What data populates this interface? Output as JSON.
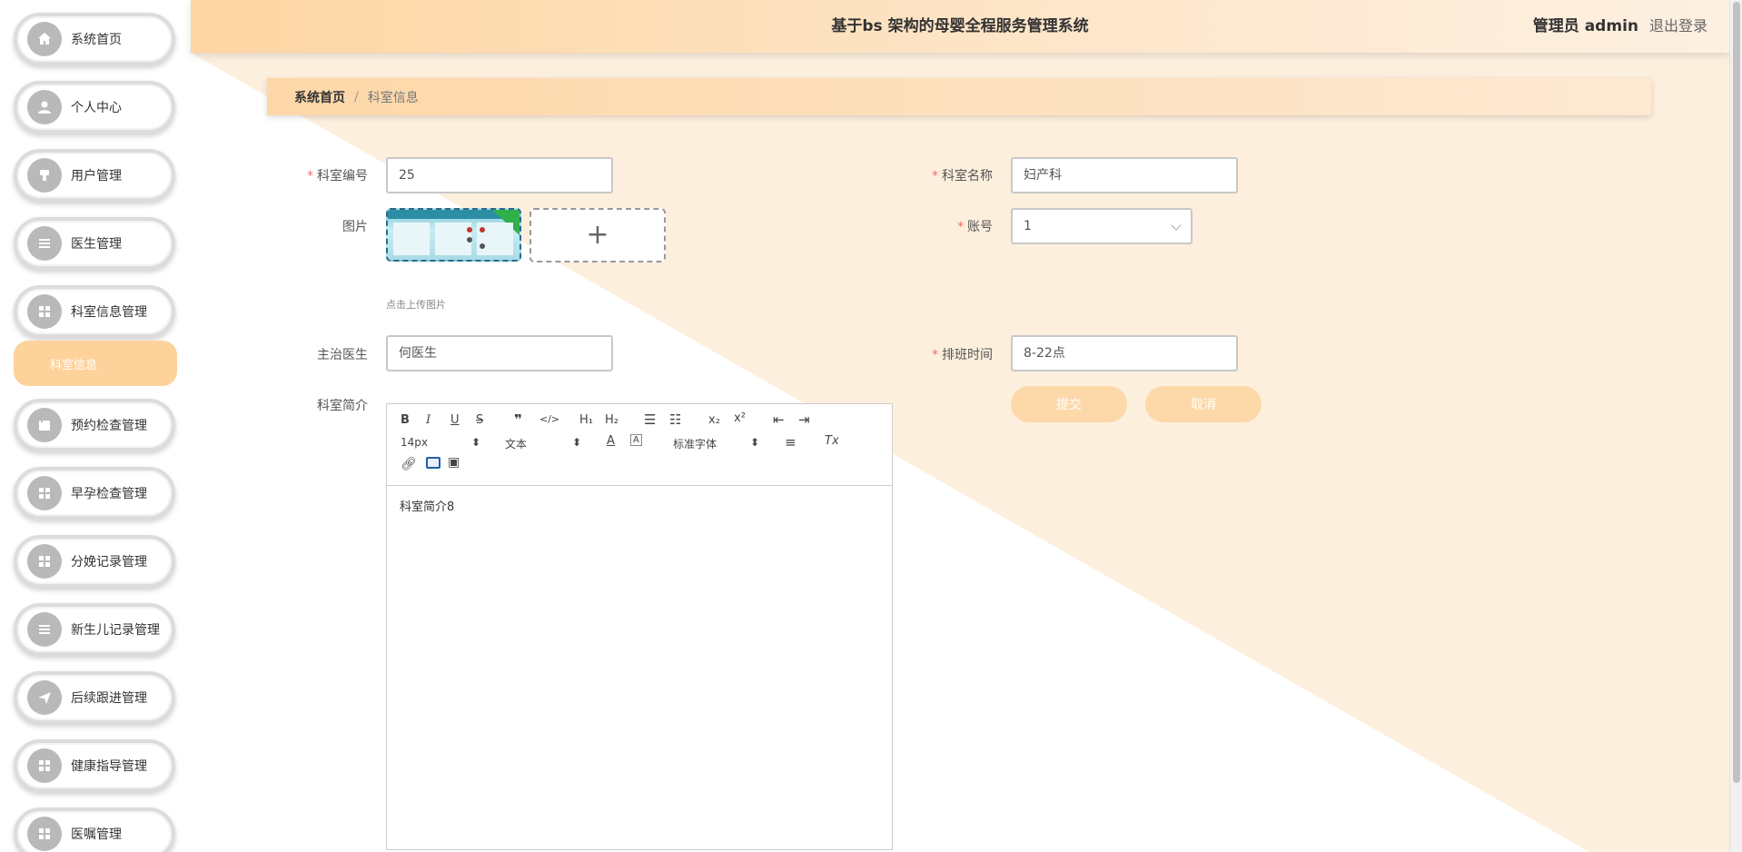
{
  "app": {
    "title": "基于bs 架构的母婴全程服务管理系统",
    "user": "管理员 admin",
    "logout": "退出登录"
  },
  "sidebar": {
    "items": [
      {
        "label": "系统首页",
        "icon": "home-icon"
      },
      {
        "label": "个人中心",
        "icon": "user-icon"
      },
      {
        "label": "用户管理",
        "icon": "user-manage-icon"
      },
      {
        "label": "医生管理",
        "icon": "list-icon"
      },
      {
        "label": "科室信息管理",
        "icon": "grid-icon"
      },
      {
        "label": "预约检查管理",
        "icon": "calendar-icon"
      },
      {
        "label": "早孕检查管理",
        "icon": "grid-icon"
      },
      {
        "label": "分娩记录管理",
        "icon": "grid-icon"
      },
      {
        "label": "新生儿记录管理",
        "icon": "list-icon"
      },
      {
        "label": "后续跟进管理",
        "icon": "send-icon"
      },
      {
        "label": "健康指导管理",
        "icon": "grid-icon"
      },
      {
        "label": "医嘱管理",
        "icon": "grid-icon"
      }
    ],
    "active_sub": "科室信息"
  },
  "breadcrumb": {
    "home": "系统首页",
    "separator": "/",
    "current": "科室信息"
  },
  "form": {
    "dept_no_label": "科室编号",
    "dept_no_value": "25",
    "dept_name_label": "科室名称",
    "dept_name_value": "妇产科",
    "image_label": "图片",
    "account_label": "账号",
    "account_value": "1",
    "upload_tip": "点击上传图片",
    "doctor_label": "主治医生",
    "doctor_value": "何医生",
    "schedule_label": "排班时间",
    "schedule_value": "8-22点",
    "intro_label": "科室简介",
    "submit": "提交",
    "cancel": "取消"
  },
  "editor": {
    "font_size": "14px",
    "block_type": "文本",
    "font_family": "标准字体",
    "content": "科室简介8"
  }
}
